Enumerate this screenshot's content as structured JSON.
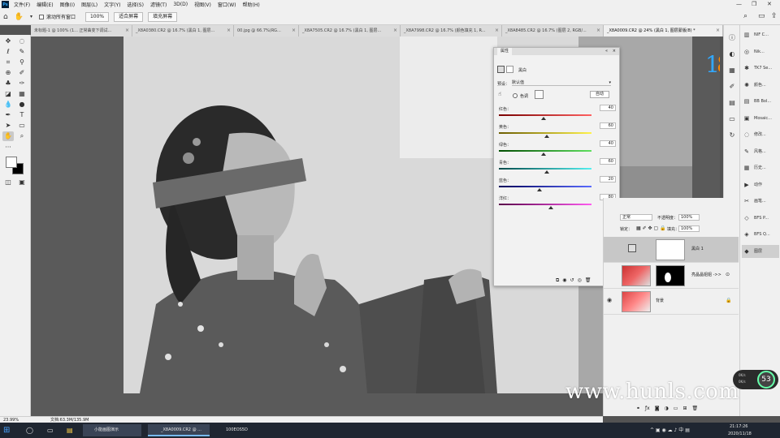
{
  "menubar": {
    "app_logo": "Ps",
    "items": [
      "文件(F)",
      "编辑(E)",
      "图像(I)",
      "图层(L)",
      "文字(Y)",
      "选择(S)",
      "滤镜(T)",
      "3D(D)",
      "视图(V)",
      "窗口(W)",
      "帮助(H)"
    ],
    "window_controls": [
      "—",
      "❐",
      "✕"
    ]
  },
  "optbar": {
    "scroll_all_label": "滚动所有窗口",
    "zoom_value": "100%",
    "fit_screen_label": "适合屏幕",
    "fill_screen_label": "填充屏幕",
    "search_icon": "search-icon",
    "workspace_icon": "workspace-icon",
    "share_icon": "share-icon"
  },
  "tabs": [
    {
      "label": "未标题-1 @ 100% (1... 正常曲变下调试..."
    },
    {
      "label": "_X8A0380.CR2 @ 16.7% (黑白 1, 图层..."
    },
    {
      "label": "00.jpg @ 66.7%(RG..."
    },
    {
      "label": "_X8A7505.CR2 @ 16.7% (黑白 1, 图层..."
    },
    {
      "label": "_X8A7998.CR2 @ 16.7% (颜色填充 1, R..."
    },
    {
      "label": "_X8A8485.CR2 @ 16.7% (图层 2, RGB/..."
    },
    {
      "label": "_X8A0009.CR2 @ 24% (黑白 1, 图层蒙版/8) *"
    }
  ],
  "properties": {
    "tab_label": "属性",
    "adjustment_name": "黑白",
    "preset_label": "预设：",
    "preset_value": "默认值",
    "tint_label": "色调",
    "auto_label": "自动",
    "sliders": [
      {
        "label": "红色：",
        "value": 40,
        "color_from": "#7a0000",
        "color_to": "#ff6060"
      },
      {
        "label": "黄色：",
        "value": 60,
        "color_from": "#6b5d00",
        "color_to": "#fff24a"
      },
      {
        "label": "绿色：",
        "value": 40,
        "color_from": "#004d00",
        "color_to": "#5fe05f"
      },
      {
        "label": "青色：",
        "value": 60,
        "color_from": "#004a4a",
        "color_to": "#56f0f0"
      },
      {
        "label": "蓝色：",
        "value": 20,
        "color_from": "#00005a",
        "color_to": "#5a6bff"
      },
      {
        "label": "洋红：",
        "value": 80,
        "color_from": "#5a004a",
        "color_to": "#ff5cf0"
      }
    ],
    "slider_min": -200,
    "slider_max": 300
  },
  "strip2": [
    {
      "icon": "histogram-icon",
      "label": "NIF C..."
    },
    {
      "icon": "camera-icon",
      "label": "Nik..."
    },
    {
      "icon": "plugin-icon",
      "label": "TK7 Se..."
    },
    {
      "icon": "adjust-icon",
      "label": "颜色..."
    },
    {
      "icon": "book-icon",
      "label": "BB Bol..."
    },
    {
      "icon": "camera-raw-icon",
      "label": "Mosaic..."
    },
    {
      "icon": "circle-icon",
      "label": "修改..."
    },
    {
      "icon": "style-icon",
      "label": "风格..."
    },
    {
      "icon": "history-icon",
      "label": "历史..."
    },
    {
      "icon": "play-icon",
      "label": "动作"
    },
    {
      "icon": "brush-icon",
      "label": "画笔..."
    },
    {
      "icon": "plugin2-icon",
      "label": "BFS P..."
    },
    {
      "icon": "plugin3-icon",
      "label": "BFS Q..."
    },
    {
      "icon": "layers-icon",
      "label": "图层"
    }
  ],
  "layers_panel": {
    "blend_mode": "正常",
    "opacity_label": "不透明度：",
    "opacity_value": "100%",
    "fill_label": "填充：",
    "fill_value": "100%",
    "lock_label": "锁定：",
    "layers": [
      {
        "name": "黑白 1",
        "selected": true
      },
      {
        "name": "亮晶晶姐姐 ->>",
        "selected": false
      },
      {
        "name": "背景",
        "selected": false
      }
    ]
  },
  "status": {
    "zoom": "23.99%",
    "doc_info": "文档:63.3M/135.9M"
  },
  "taskbar": {
    "apps": [
      "小能画图演示",
      "_X8A0009.CR2 @ ...",
      "100EOS5D"
    ],
    "time": "21:17:26",
    "date": "2020/11/18"
  },
  "watermark": "www.hunls.com",
  "cpu_badge": {
    "percent": "53",
    "stat_up": "0K/s",
    "stat_down": "0K/s"
  },
  "colors": {
    "accent": "#31a8ff",
    "panel_bg": "#f0f0f0",
    "canvas_bg": "#5a5a5a"
  }
}
